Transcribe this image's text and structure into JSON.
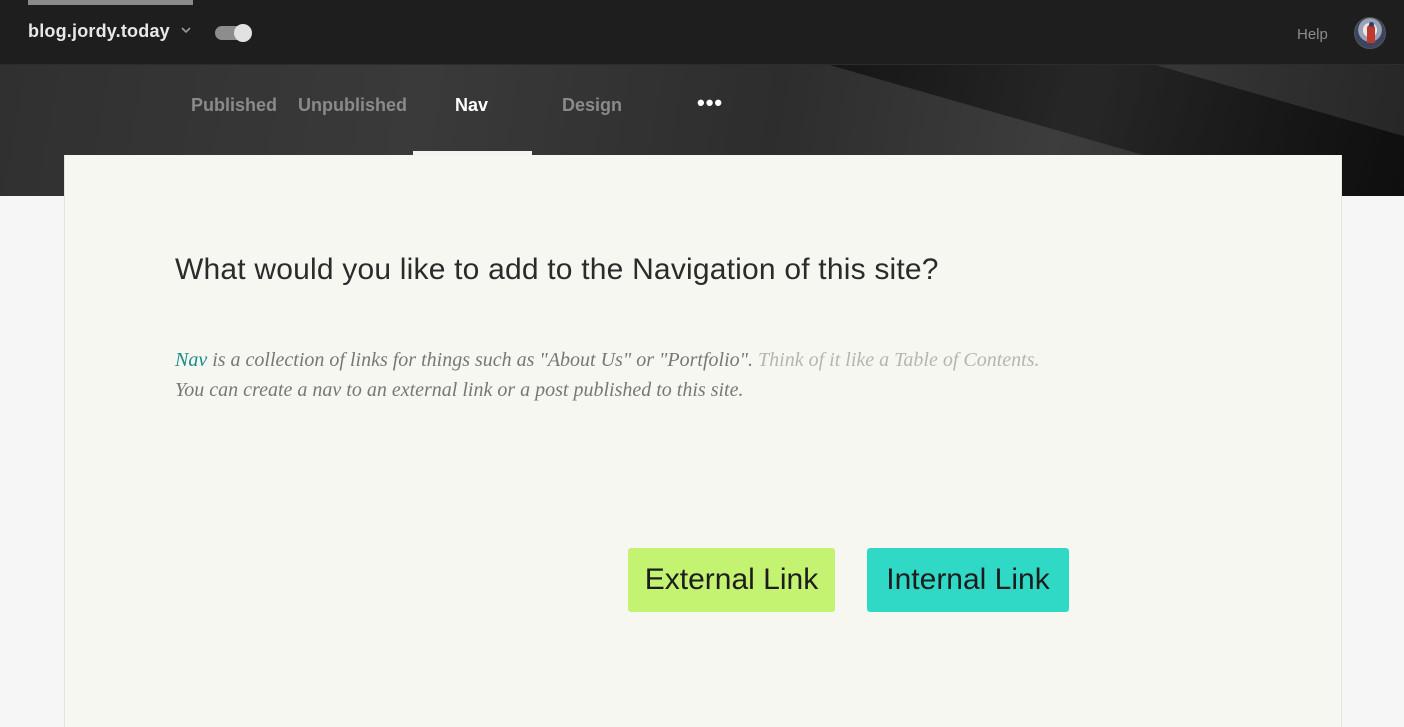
{
  "topbar": {
    "site_name": "blog.jordy.today",
    "site_chevron_icon": "chevron-down-icon",
    "toggle_state": "on",
    "help_label": "Help",
    "avatar_icon": "user-avatar"
  },
  "tabs": [
    {
      "label": "Published",
      "active": false
    },
    {
      "label": "Unpublished",
      "active": false
    },
    {
      "label": "Nav",
      "active": true
    },
    {
      "label": "Design",
      "active": false
    }
  ],
  "more_label": "•••",
  "main": {
    "title": "What would you like to add to the Navigation of this site?",
    "desc_nav_word": "Nav",
    "desc_line1": " is a collection of links for things such as \"About Us\" or \"Portfolio\". ",
    "desc_muted": "Think of it like a Table of Contents.",
    "desc_line2": "You can create a nav to an external link or a post published to this site.",
    "external_button": "External Link",
    "internal_button": "Internal Link"
  },
  "colors": {
    "external_button": "#c4f271",
    "internal_button": "#2fd9c6",
    "nav_accent": "#1a8c8c"
  }
}
